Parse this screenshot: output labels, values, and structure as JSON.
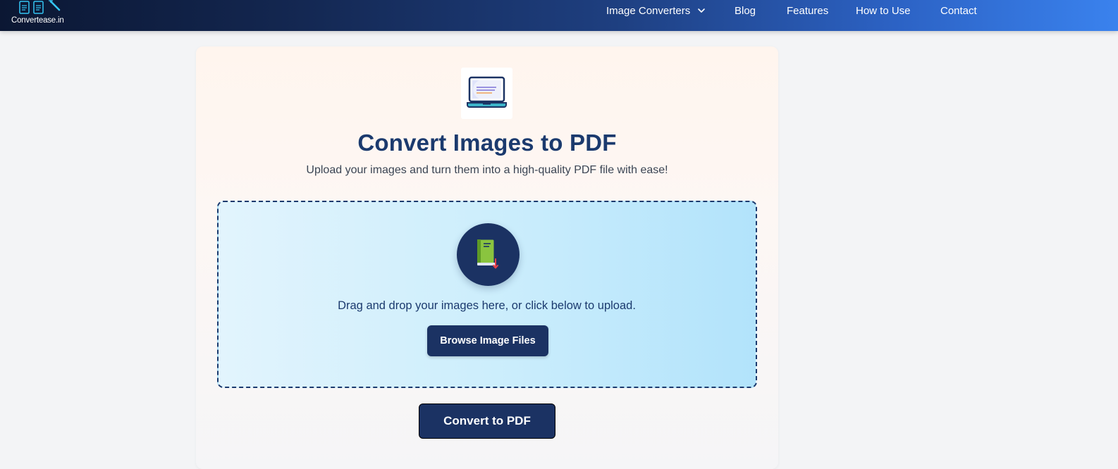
{
  "nav": {
    "brand": "Convertease.in",
    "items": [
      {
        "label": "Image Converters"
      },
      {
        "label": "Blog"
      },
      {
        "label": "Features"
      },
      {
        "label": "How to Use"
      },
      {
        "label": "Contact"
      }
    ]
  },
  "card": {
    "title": "Convert Images to PDF",
    "subtitle": "Upload your images and turn them into a high-quality PDF file with ease!",
    "dropzone": {
      "text": "Drag and drop your images here, or click below to upload.",
      "browse_label": "Browse Image Files"
    },
    "convert_label": "Convert to PDF"
  },
  "icons": {
    "hero": "laptop-icon",
    "dropzone": "book-download-icon",
    "nav_dropdown": "chevron-down-icon",
    "brand": "document-convert-logo"
  },
  "colors": {
    "primary": "#1b3263",
    "title": "#1b3a6e",
    "nav_gradient_start": "#0b1733",
    "nav_gradient_end": "#3a82ee",
    "dropzone_start": "#e2f4fd",
    "dropzone_end": "#b2e3fb"
  }
}
